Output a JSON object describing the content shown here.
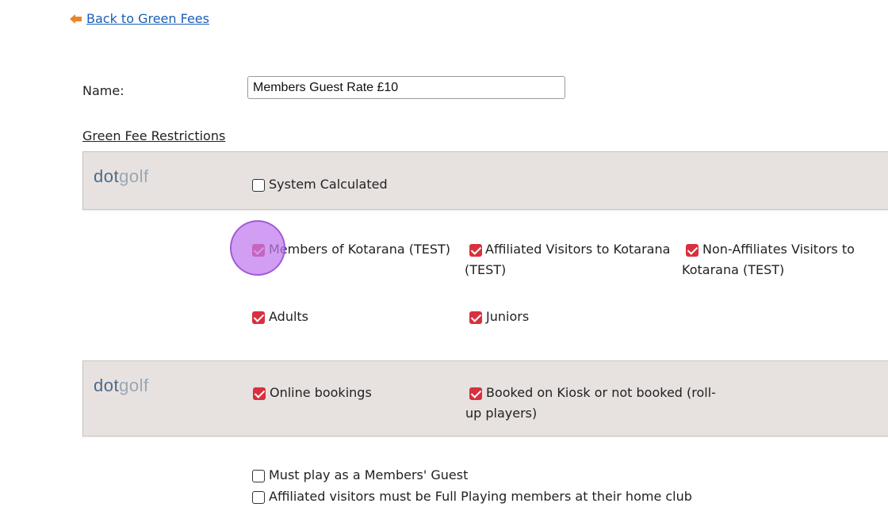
{
  "nav": {
    "back_label": "Back to Green Fees",
    "accent": "#e8862a"
  },
  "form": {
    "name_label": "Name:",
    "name_value": "Members Guest Rate £10",
    "section_title": "Green Fee Restrictions"
  },
  "panels": [
    {
      "logo_a": "dot",
      "logo_b": "golf",
      "items": [
        {
          "label": "System Calculated",
          "checked": false
        }
      ]
    },
    {
      "logo_a": "dot",
      "logo_b": "golf",
      "items": [
        {
          "label": "Online bookings",
          "checked": true
        },
        {
          "label": "Booked on Kiosk or not booked (roll-up players)",
          "checked": true
        }
      ]
    }
  ],
  "membership": [
    {
      "label": "Members of Kotarana (TEST)",
      "checked": true
    },
    {
      "label": "Affiliated Visitors to Kotarana (TEST)",
      "checked": true
    },
    {
      "label": "Non-Affiliates Visitors to Kotarana (TEST)",
      "checked": true
    }
  ],
  "age": [
    {
      "label": "Adults",
      "checked": true
    },
    {
      "label": "Juniors",
      "checked": true
    }
  ],
  "extra": [
    {
      "label": "Must play as a Members' Guest",
      "checked": false
    },
    {
      "label": "Affiliated visitors must be Full Playing members at their home club",
      "checked": false
    }
  ],
  "colors": {
    "check": "#d9303e",
    "link": "#1a5fb4",
    "panel": "#e7e2e0",
    "pointer": "#bf78f0"
  }
}
